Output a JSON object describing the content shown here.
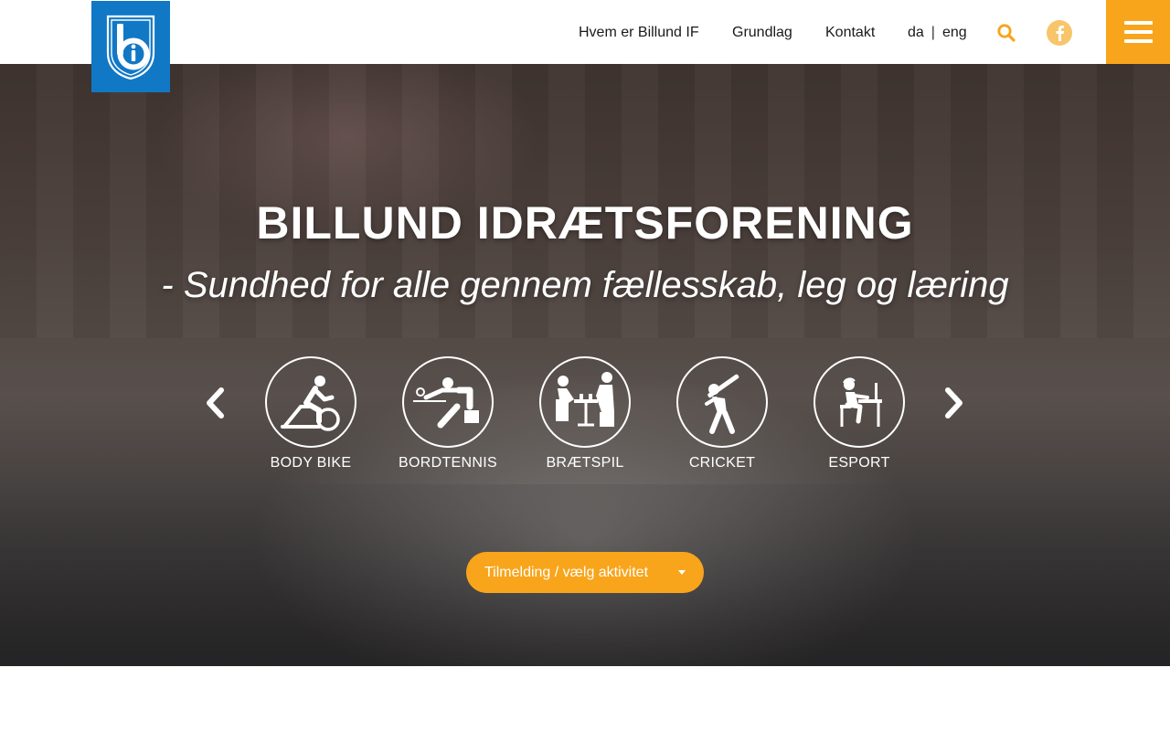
{
  "header": {
    "logo_icon": "billund-if-logo-icon",
    "nav": [
      {
        "label": "Hvem er Billund IF"
      },
      {
        "label": "Grundlag"
      },
      {
        "label": "Kontakt"
      }
    ],
    "lang": {
      "da": "da",
      "separator": "|",
      "eng": "eng"
    },
    "search_icon": "search-icon",
    "facebook_icon": "facebook-icon",
    "menu_icon": "hamburger-menu-icon"
  },
  "hero": {
    "title": "BILLUND IDRÆTSFORENING",
    "subtitle": "- Sundhed for alle gennem fællesskab, leg og læring"
  },
  "carousel": {
    "prev_icon": "chevron-left-icon",
    "next_icon": "chevron-right-icon",
    "activities": [
      {
        "label": "BODY BIKE",
        "icon": "cycling-icon"
      },
      {
        "label": "BORDTENNIS",
        "icon": "table-tennis-icon"
      },
      {
        "label": "BRÆTSPIL",
        "icon": "board-game-icon"
      },
      {
        "label": "CRICKET",
        "icon": "cricket-icon"
      },
      {
        "label": "ESPORT",
        "icon": "esport-icon"
      }
    ]
  },
  "signup": {
    "label": "Tilmelding / vælg aktivitet",
    "icon": "caret-down-icon"
  },
  "colors": {
    "brand_blue": "#1178c5",
    "accent_orange": "#f8a51c",
    "facebook_bg": "#f8c56a"
  }
}
